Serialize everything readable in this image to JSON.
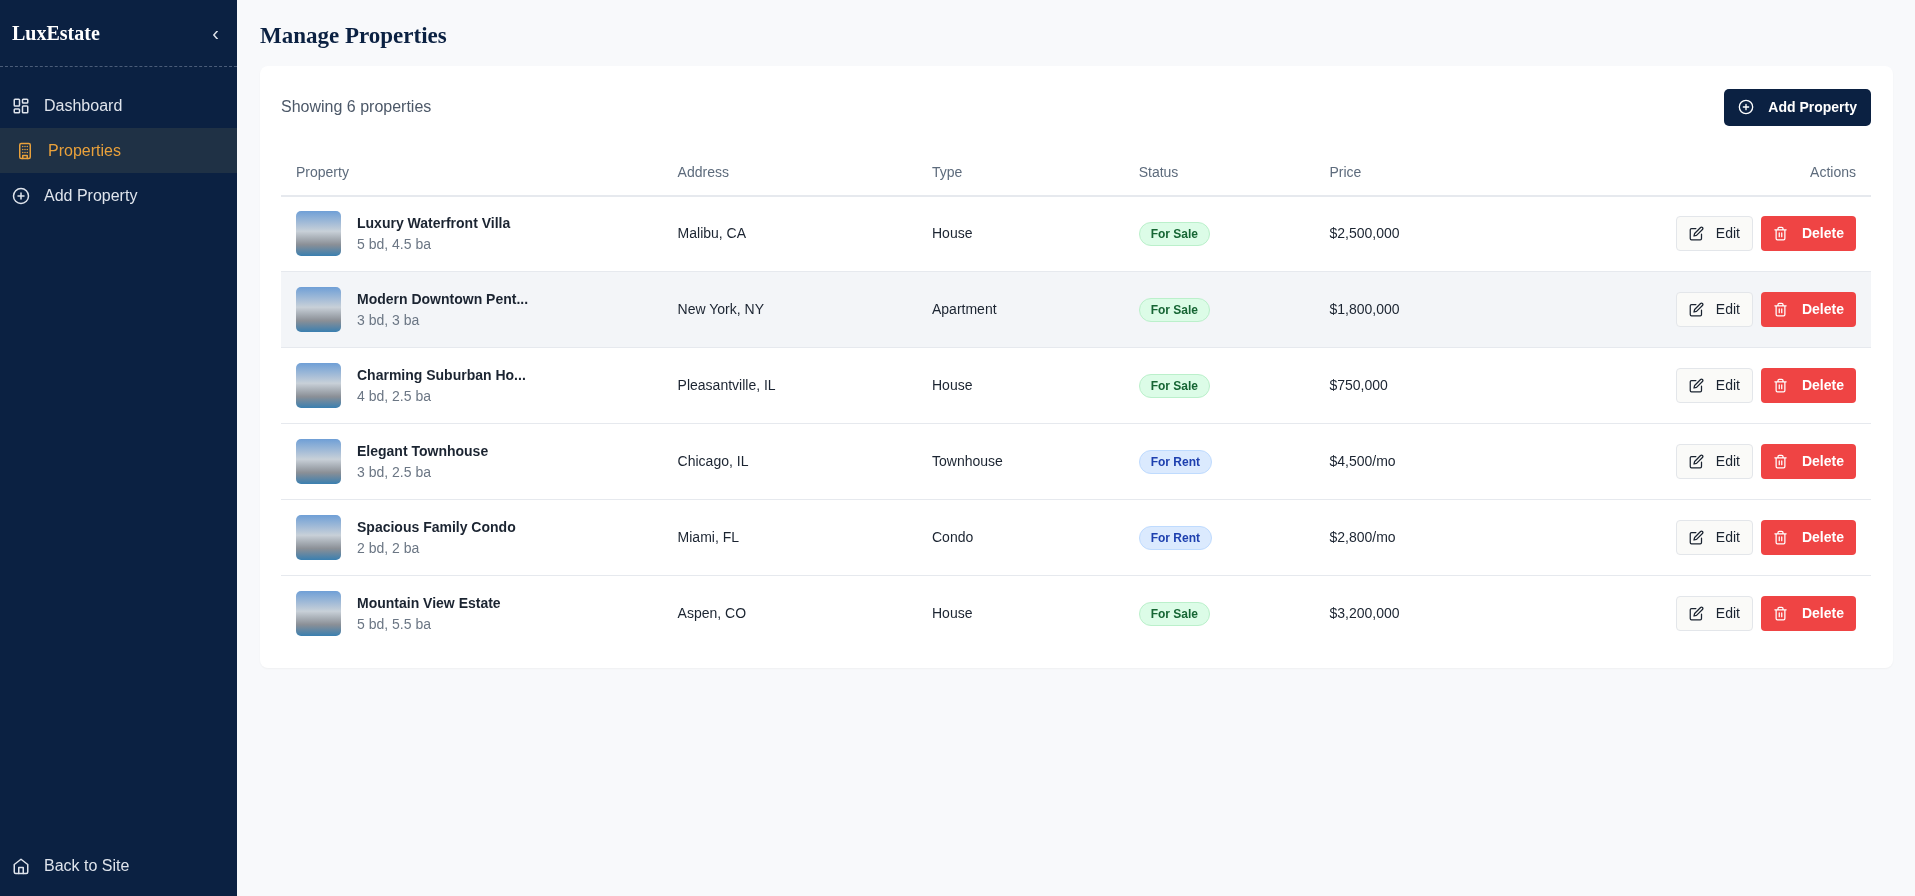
{
  "sidebar": {
    "brand": "LuxEstate",
    "collapse_icon": "‹",
    "items": [
      {
        "label": "Dashboard",
        "selected": false
      },
      {
        "label": "Properties",
        "selected": true
      },
      {
        "label": "Add Property",
        "selected": false
      }
    ],
    "footer_link": "Back to Site"
  },
  "page_title": "Manage Properties",
  "summary": "Showing 6 properties",
  "add_button": "Add Property",
  "table": {
    "columns": [
      "Property",
      "Address",
      "Type",
      "Status",
      "Price",
      "Actions"
    ],
    "rows": [
      {
        "name": "Luxury Waterfront Villa",
        "details": "5 bd, 4.5 ba",
        "address": "Malibu, CA",
        "type": "House",
        "status": {
          "label": "For Sale",
          "kind": "sale"
        },
        "price": "$2,500,000",
        "hovered": false,
        "edit": "Edit",
        "delete": "Delete"
      },
      {
        "name": "Modern Downtown Pent...",
        "details": "3 bd, 3 ba",
        "address": "New York, NY",
        "type": "Apartment",
        "status": {
          "label": "For Sale",
          "kind": "sale"
        },
        "price": "$1,800,000",
        "hovered": true,
        "edit": "Edit",
        "delete": "Delete"
      },
      {
        "name": "Charming Suburban Ho...",
        "details": "4 bd, 2.5 ba",
        "address": "Pleasantville, IL",
        "type": "House",
        "status": {
          "label": "For Sale",
          "kind": "sale"
        },
        "price": "$750,000",
        "hovered": false,
        "edit": "Edit",
        "delete": "Delete"
      },
      {
        "name": "Elegant Townhouse",
        "details": "3 bd, 2.5 ba",
        "address": "Chicago, IL",
        "type": "Townhouse",
        "status": {
          "label": "For Rent",
          "kind": "rent"
        },
        "price": "$4,500/mo",
        "hovered": false,
        "edit": "Edit",
        "delete": "Delete"
      },
      {
        "name": "Spacious Family Condo",
        "details": "2 bd, 2 ba",
        "address": "Miami, FL",
        "type": "Condo",
        "status": {
          "label": "For Rent",
          "kind": "rent"
        },
        "price": "$2,800/mo",
        "hovered": false,
        "edit": "Edit",
        "delete": "Delete"
      },
      {
        "name": "Mountain View Estate",
        "details": "5 bd, 5.5 ba",
        "address": "Aspen, CO",
        "type": "House",
        "status": {
          "label": "For Sale",
          "kind": "sale"
        },
        "price": "$3,200,000",
        "hovered": false,
        "edit": "Edit",
        "delete": "Delete"
      }
    ]
  }
}
